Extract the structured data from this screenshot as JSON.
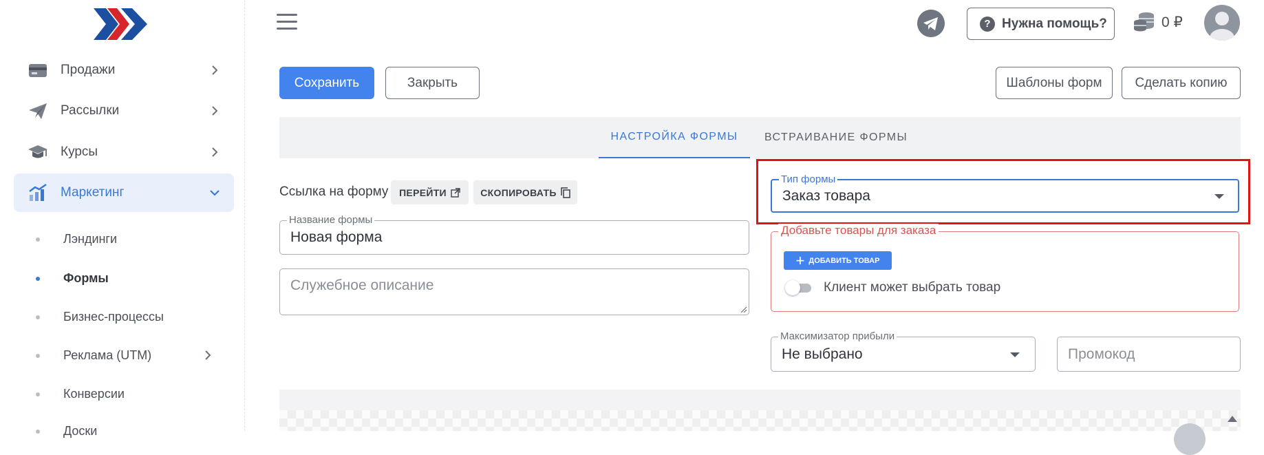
{
  "brand": {
    "logo_colors": [
      "#1d4fa0",
      "#d7262b"
    ]
  },
  "sidebar": {
    "items": [
      {
        "label": "Продажи",
        "icon": "card-icon"
      },
      {
        "label": "Рассылки",
        "icon": "paper-plane-icon"
      },
      {
        "label": "Курсы",
        "icon": "graduation-cap-icon"
      },
      {
        "label": "Маркетинг",
        "icon": "growth-chart-icon",
        "expanded": true
      }
    ],
    "sub_items": [
      {
        "label": "Лэндинги"
      },
      {
        "label": "Формы",
        "active": true
      },
      {
        "label": "Бизнес-процессы"
      },
      {
        "label": "Реклама (UTM)"
      },
      {
        "label": "Конверсии"
      },
      {
        "label": "Доски"
      }
    ]
  },
  "header": {
    "help_label": "Нужна помощь?",
    "balance": "0 ₽"
  },
  "toolbar": {
    "save_label": "Сохранить",
    "close_label": "Закрыть",
    "templates_label": "Шаблоны форм",
    "copy_label": "Сделать копию"
  },
  "tabs": [
    {
      "label": "НАСТРОЙКА ФОРМЫ",
      "active": true
    },
    {
      "label": "ВСТРАИВАНИЕ ФОРМЫ",
      "active": false
    }
  ],
  "form": {
    "link_label": "Ссылка на форму",
    "go_label": "ПЕРЕЙТИ",
    "copy_link_label": "СКОПИРОВАТЬ",
    "name_legend": "Название формы",
    "name_value": "Новая форма",
    "description_placeholder": "Служебное описание",
    "type_legend": "Тип формы",
    "type_value": "Заказ товара",
    "products_legend": "Добавьте товары для заказа",
    "add_product_label": "ДОБАВИТЬ ТОВАР",
    "client_choice_label": "Клиент может выбрать товар",
    "client_choice_on": false,
    "maximizer_legend": "Максимизатор прибыли",
    "maximizer_value": "Не выбрано",
    "promo_placeholder": "Промокод"
  },
  "colors": {
    "accent": "#4283ee",
    "highlight": "#e01414",
    "error": "#e05050"
  }
}
